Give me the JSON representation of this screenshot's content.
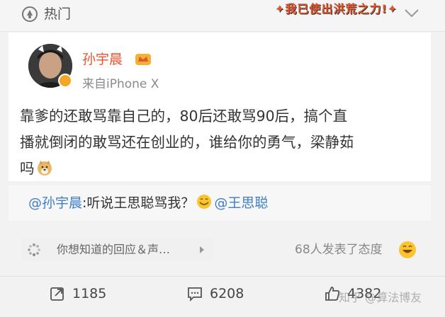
{
  "header": {
    "title": "热门",
    "slogan": "✦我已使出洪荒之力!✦"
  },
  "post": {
    "author": "孙宇晨",
    "source": "来自iPhone X",
    "text_line1": "靠爹的还敢骂靠自己的，80后还敢骂90后，搞个直",
    "text_line2": "播就倒闭的敢骂还在创业的，谁给你的勇气，梁静茹",
    "text_line3": "吗"
  },
  "repost": {
    "mention1": "@孙宇晨",
    "text": ":听说王思聪骂我？",
    "mention2": "@王思聪"
  },
  "feedback": {
    "prompt": "你想知道的回应＆声…",
    "attitude": "68人发表了态度"
  },
  "actions": {
    "reposts": "1185",
    "comments": "6208",
    "likes": "4382"
  },
  "watermark": "知乎 @算法博友",
  "colors": {
    "author_name": "#e6552e",
    "mention": "#3d7ec9",
    "slogan": "#e4572e"
  }
}
